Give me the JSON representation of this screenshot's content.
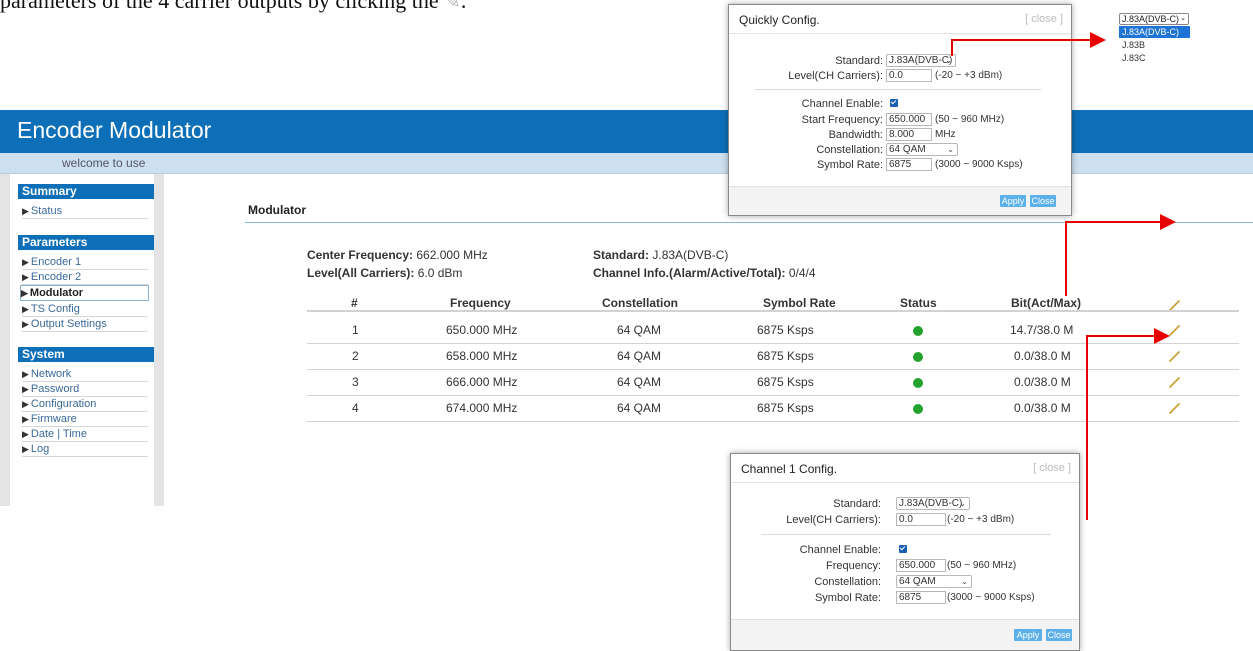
{
  "doc": {
    "line_text": "parameters of the 4 carrier outputs by clicking the",
    "line_end": "."
  },
  "app": {
    "title": "Encoder Modulator",
    "welcome": "welcome to use"
  },
  "sidebar": {
    "summary_head": "Summary",
    "summary_items": [
      "Status"
    ],
    "parameters_head": "Parameters",
    "parameter_items": [
      "Encoder 1",
      "Encoder 2",
      "Modulator",
      "TS Config",
      "Output Settings"
    ],
    "active_item": "Modulator",
    "system_head": "System",
    "system_items": [
      "Network",
      "Password",
      "Configuration",
      "Firmware",
      "Date | Time",
      "Log"
    ]
  },
  "main": {
    "title": "Modulator",
    "center_freq_label": "Center Frequency:",
    "center_freq_value": "662.000 MHz",
    "level_label": "Level(All Carriers):",
    "level_value": "6.0 dBm",
    "standard_label": "Standard:",
    "standard_value": "J.83A(DVB-C)",
    "channel_info_label": "Channel Info.(Alarm/Active/Total):",
    "channel_info_value": "0/4/4",
    "columns": [
      "#",
      "Frequency",
      "Constellation",
      "Symbol Rate",
      "Status",
      "Bit(Act/Max)"
    ],
    "rows": [
      {
        "num": "1",
        "freq": "650.000 MHz",
        "const": "64 QAM",
        "rate": "6875 Ksps",
        "bit": "14.7/38.0 M"
      },
      {
        "num": "2",
        "freq": "658.000 MHz",
        "const": "64 QAM",
        "rate": "6875 Ksps",
        "bit": "0.0/38.0 M"
      },
      {
        "num": "3",
        "freq": "666.000 MHz",
        "const": "64 QAM",
        "rate": "6875 Ksps",
        "bit": "0.0/38.0 M"
      },
      {
        "num": "4",
        "freq": "674.000 MHz",
        "const": "64 QAM",
        "rate": "6875 Ksps",
        "bit": "0.0/38.0 M"
      }
    ],
    "status_color": "#23a22d",
    "edit_icon": "pencil-icon"
  },
  "quick_config": {
    "title": "Quickly Config.",
    "close": "[ close ]",
    "standard_label": "Standard:",
    "standard_value": "J.83A(DVB-C)",
    "level_label": "Level(CH Carriers):",
    "level_value": "0.0",
    "level_hint": "(-20 ~ +3 dBm)",
    "enable_label": "Channel Enable:",
    "start_freq_label": "Start Frequency:",
    "start_freq_value": "650.000",
    "start_freq_hint": "(50 ~ 960 MHz)",
    "bandwidth_label": "Bandwidth:",
    "bandwidth_value": "8.000",
    "bandwidth_unit": "MHz",
    "constellation_label": "Constellation:",
    "constellation_value": "64 QAM",
    "symbol_rate_label": "Symbol Rate:",
    "symbol_rate_value": "6875",
    "symbol_rate_hint": "(3000 ~ 9000 Ksps)",
    "apply": "Apply",
    "close_btn": "Close"
  },
  "standard_dropdown": {
    "selected": "J.83A(DVB-C)",
    "options": [
      "J.83A(DVB-C)",
      "J.83B",
      "J.83C"
    ],
    "highlight_color": "#1e74d6"
  },
  "channel_config": {
    "title": "Channel 1 Config.",
    "close": "[ close ]",
    "standard_label": "Standard:",
    "standard_value": "J.83A(DVB-C)",
    "level_label": "Level(CH Carriers):",
    "level_value": "0.0",
    "level_hint": "(-20 ~ +3 dBm)",
    "enable_label": "Channel Enable:",
    "freq_label": "Frequency:",
    "freq_value": "650.000",
    "freq_hint": "(50 ~ 960 MHz)",
    "constellation_label": "Constellation:",
    "constellation_value": "64 QAM",
    "symbol_rate_label": "Symbol Rate:",
    "symbol_rate_value": "6875",
    "symbol_rate_hint": "(3000 ~ 9000 Ksps)",
    "apply": "Apply",
    "close_btn": "Close"
  },
  "colors": {
    "brand_blue": "#0d6fb8",
    "arrow_red": "#e60000",
    "button_blue": "#5cb0ea"
  }
}
